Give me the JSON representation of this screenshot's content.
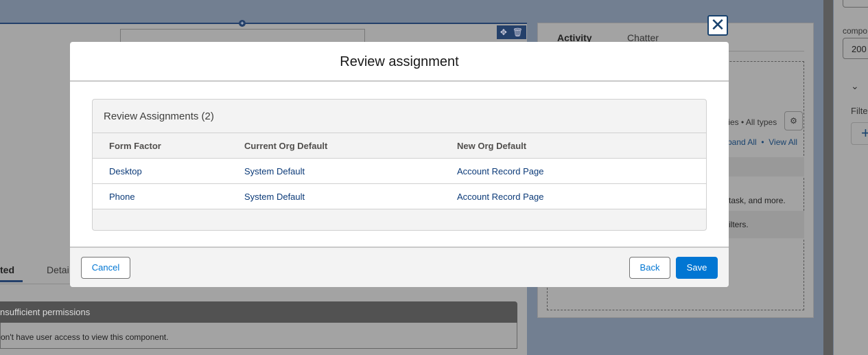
{
  "background": {
    "left_tabs": {
      "active": "ted",
      "details": "Detai"
    },
    "permissions": {
      "title": "nsufficient permissions",
      "message": "on't have user access to view this component."
    },
    "right_tabs": {
      "activity": "Activity",
      "chatter": "Chatter"
    },
    "activity": {
      "filter_text": "ties • All types",
      "expand_all": "pand All",
      "separator": "•",
      "view_all": "View All",
      "empty_text": "task, and more.",
      "filters_text": "ilters."
    },
    "props": {
      "component_label": "compo",
      "value": "200",
      "filter_label": "Filte"
    }
  },
  "modal": {
    "title": "Review assignment",
    "close_icon": "close-icon",
    "table": {
      "title": "Review Assignments (2)",
      "columns": [
        "Form Factor",
        "Current Org Default",
        "New Org Default"
      ],
      "rows": [
        [
          "Desktop",
          "System Default",
          "Account Record Page"
        ],
        [
          "Phone",
          "System Default",
          "Account Record Page"
        ]
      ]
    },
    "buttons": {
      "cancel": "Cancel",
      "back": "Back",
      "save": "Save"
    }
  },
  "colors": {
    "brand": "#0176d3",
    "overlay": "#727f91"
  }
}
